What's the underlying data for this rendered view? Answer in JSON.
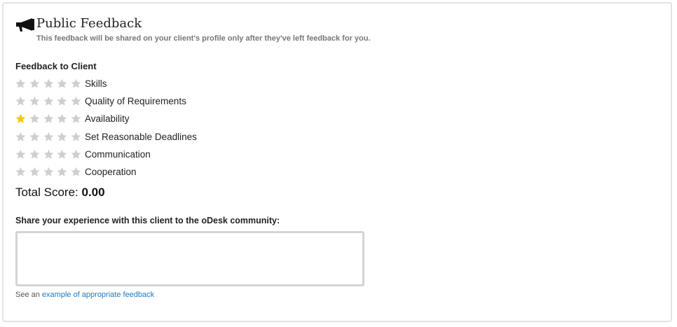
{
  "header": {
    "icon": "megaphone-icon",
    "title": "Public Feedback",
    "subtitle": "This feedback will be shared on your client's profile only after they've left feedback for you."
  },
  "section_label": "Feedback to Client",
  "colors": {
    "star_filled": "#f5c518",
    "star_empty": "#cfcfcf",
    "link": "#1a7ac4"
  },
  "ratings": [
    {
      "label": "Skills",
      "value": 0,
      "max": 5
    },
    {
      "label": "Quality of Requirements",
      "value": 0,
      "max": 5
    },
    {
      "label": "Availability",
      "value": 1,
      "max": 5
    },
    {
      "label": "Set Reasonable Deadlines",
      "value": 0,
      "max": 5
    },
    {
      "label": "Communication",
      "value": 0,
      "max": 5
    },
    {
      "label": "Cooperation",
      "value": 0,
      "max": 5
    }
  ],
  "total": {
    "label": "Total Score:",
    "value": "0.00"
  },
  "share": {
    "label": "Share your experience with this client to the oDesk community:",
    "value": "",
    "placeholder": ""
  },
  "example": {
    "prefix": "See an",
    "link_text": "example of appropriate feedback"
  }
}
